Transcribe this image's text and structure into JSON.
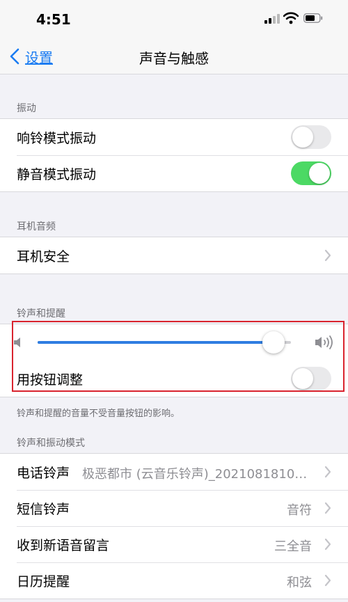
{
  "status": {
    "time": "4:51"
  },
  "nav": {
    "back_label": "设置",
    "title": "声音与触感"
  },
  "vibration": {
    "header": "振动",
    "rows": [
      {
        "label": "响铃模式振动",
        "on": false
      },
      {
        "label": "静音模式振动",
        "on": true
      }
    ]
  },
  "headphone": {
    "header": "耳机音频",
    "rows": [
      {
        "label": "耳机安全"
      }
    ]
  },
  "ringer": {
    "header": "铃声和提醒",
    "volume": 0.93,
    "adjust_label": "用按钮调整",
    "adjust_on": false,
    "footer": "铃声和提醒的音量不受音量按钮的影响。"
  },
  "patterns": {
    "header": "铃声和振动模式",
    "rows": [
      {
        "label": "电话铃声",
        "value": "极恶都市 (云音乐铃声)_20210818101..."
      },
      {
        "label": "短信铃声",
        "value": "音符"
      },
      {
        "label": "收到新语音留言",
        "value": "三全音"
      },
      {
        "label": "日历提醒",
        "value": "和弦"
      }
    ]
  },
  "colors": {
    "accent": "#1a7cf2",
    "toggle_on": "#4cd964",
    "highlight": "#d9232e"
  }
}
